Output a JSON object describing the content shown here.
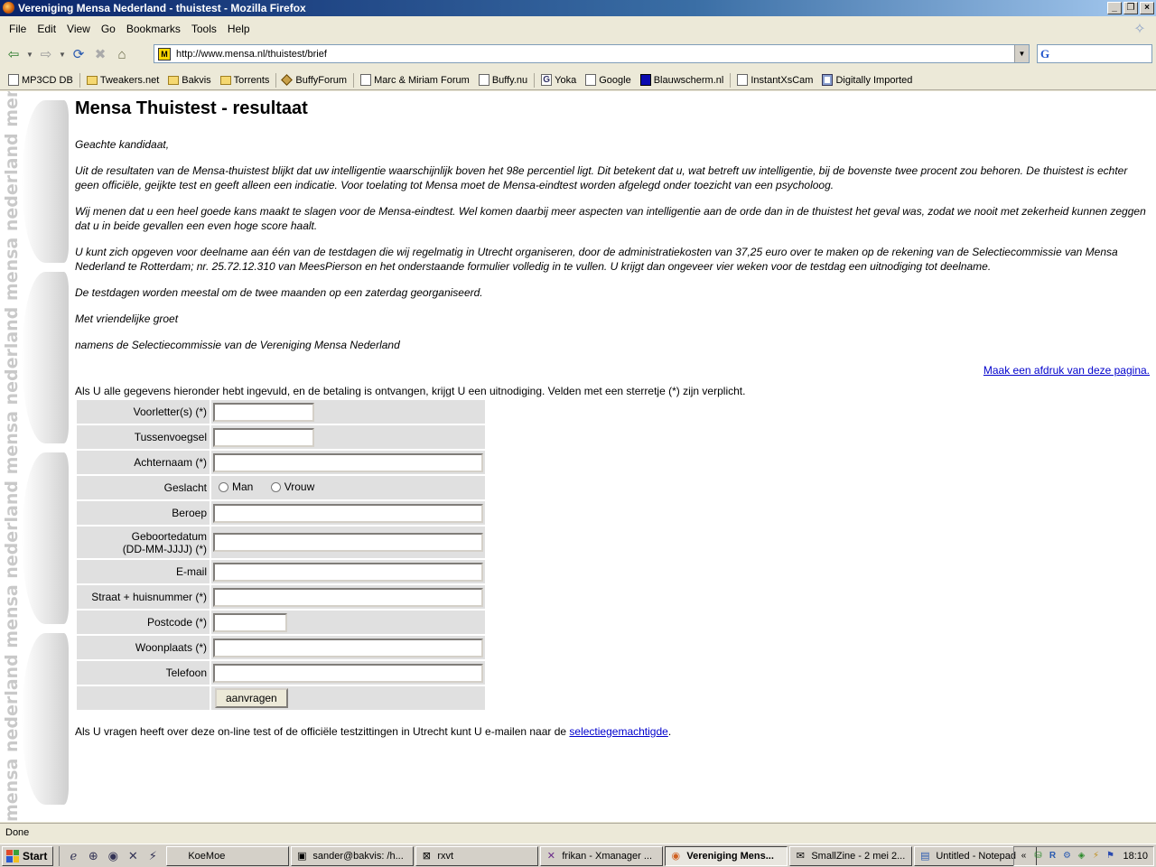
{
  "window": {
    "title": "Vereniging Mensa Nederland - thuistest - Mozilla Firefox"
  },
  "menu": [
    "File",
    "Edit",
    "View",
    "Go",
    "Bookmarks",
    "Tools",
    "Help"
  ],
  "nav": {
    "url": "http://www.mensa.nl/thuistest/brief"
  },
  "bookmarks": [
    "MP3CD DB",
    "Tweakers.net",
    "Bakvis",
    "Torrents",
    "BuffyForum",
    "Marc & Miriam Forum",
    "Buffy.nu",
    "Yoka",
    "Google",
    "Blauwscherm.nl",
    "InstantXsCam",
    "Digitally Imported"
  ],
  "side_band": {
    "text": "mensa nederland mensa nederland mensa nederland mensa nederland mensa nederland mensa nederland mensa nederland mensa nederland"
  },
  "page": {
    "title": "Mensa Thuistest - resultaat",
    "greeting": "Geachte kandidaat,",
    "paragraphs": [
      "Uit de resultaten van de Mensa-thuistest blijkt dat uw intelligentie waarschijnlijk boven het 98e percentiel ligt. Dit betekent dat u, wat betreft uw intelligentie, bij de bovenste twee procent zou behoren. De thuistest is echter geen officiële, geijkte test en geeft alleen een indicatie. Voor toelating tot Mensa moet de Mensa-eindtest worden afgelegd onder toezicht van een psycholoog.",
      "Wij menen dat u een heel goede kans maakt te slagen voor de Mensa-eindtest. Wel komen daarbij meer aspecten van intelligentie aan de orde dan in de thuistest het geval was, zodat we nooit met zekerheid kunnen zeggen dat u in beide gevallen een even hoge score haalt.",
      "U kunt zich opgeven voor deelname aan één van de testdagen die wij regelmatig in Utrecht organiseren, door de administratiekosten van 37,25 euro over te maken op de rekening van de Selectiecommissie van Mensa Nederland te Rotterdam; nr. 25.72.12.310 van MeesPierson en het onderstaande formulier volledig in te vullen. U krijgt dan ongeveer vier weken voor de testdag een uitnodiging tot deelname.",
      "De testdagen worden meestal om de twee maanden op een zaterdag georganiseerd."
    ],
    "closing": "Met vriendelijke groet",
    "signature": "namens de Selectiecommissie van de Vereniging Mensa Nederland",
    "print_link": "Maak een afdruk van deze pagina.",
    "form_intro": "Als U alle gegevens hieronder hebt ingevuld, en de betaling is ontvangen, krijgt U een uitnodiging. Velden met een sterretje (*) zijn verplicht.",
    "form": {
      "voorletters": "Voorletter(s) (*)",
      "tussenvoegsel": "Tussenvoegsel",
      "achternaam": "Achternaam (*)",
      "geslacht": "Geslacht",
      "man": "Man",
      "vrouw": "Vrouw",
      "beroep": "Beroep",
      "geboortedatum_1": "Geboortedatum",
      "geboortedatum_2": "(DD-MM-JJJJ) (*)",
      "email": "E-mail",
      "straat": "Straat + huisnummer (*)",
      "postcode": "Postcode (*)",
      "woonplaats": "Woonplaats (*)",
      "telefoon": "Telefoon",
      "submit": "aanvragen"
    },
    "footer_text": "Als U vragen heeft over deze on-line test of de officiële testzittingen in Utrecht kunt U e-mailen naar de ",
    "footer_link": "selectiegemachtigde",
    "footer_end": "."
  },
  "status": "Done",
  "taskbar": {
    "start": "Start",
    "tasks": [
      "KoeMoe",
      "sander@bakvis: /h...",
      "rxvt",
      "frikan - Xmanager ...",
      "Vereniging Mens...",
      "SmallZine - 2 mei 2...",
      "Untitled - Notepad"
    ],
    "clock": "18:10",
    "tray_chevron": "«"
  }
}
